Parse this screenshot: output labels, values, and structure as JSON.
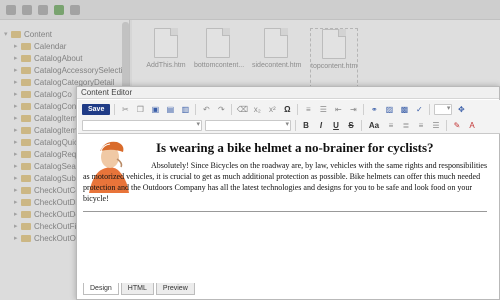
{
  "tree": {
    "root": "Content",
    "items": [
      "Calendar",
      "CatalogAbout",
      "CatalogAccessorySelection",
      "CatalogCategoryDetail",
      "CatalogCo",
      "CatalogCon",
      "CatalogItem",
      "CatalogItem",
      "CatalogQuick",
      "CatalogReque",
      "CatalogSear",
      "CatalogSubs",
      "CheckOutCo",
      "CheckOutDi",
      "CheckOutDe",
      "CheckOutFi",
      "CheckOutOr"
    ]
  },
  "files": [
    {
      "name": "AddThis.htm"
    },
    {
      "name": "bottomcontent..."
    },
    {
      "name": "sidecontent.htm"
    },
    {
      "name": "topcontent.htm"
    }
  ],
  "dialog": {
    "title": "Content Editor",
    "save_label": "Save"
  },
  "content": {
    "heading": "Is wearing a bike helmet a no-brainer for cyclists?",
    "paragraph": "Absolutely! Since Bicycles on the roadway are, by law, vehicles with the same rights and responsibilities as motorized vehicles, it is crucial to get as much additional protection as possible. Bike helmets can offer this much needed protection and the Outdoors Company has all the latest technologies and designs for you to be safe and look food on your bicycle!"
  },
  "tabs": [
    "Design",
    "HTML",
    "Preview"
  ],
  "colors": {
    "save_button": "#1f3b86",
    "folder": "#d9b96a"
  },
  "icons": {
    "toolbar_row1": [
      "cut-icon",
      "copy-icon",
      "paste-icon",
      "paste-text-icon",
      "paste-word-icon",
      "undo-icon",
      "redo-icon",
      "format-stripper-icon",
      "subscript-icon",
      "superscript-icon",
      "symbol-icon",
      "numbered-list-icon",
      "bullet-list-icon",
      "outdent-icon",
      "indent-icon",
      "link-icon",
      "image-icon",
      "media-icon",
      "spellcheck-icon",
      "table-icon",
      "module-icon"
    ],
    "toolbar_row2": [
      "bold-icon",
      "italic-icon",
      "underline-icon",
      "strikethrough-icon",
      "font-size-icon",
      "align-left-icon",
      "align-center-icon",
      "align-right-icon",
      "justify-icon",
      "highlight-color-icon",
      "font-color-icon"
    ]
  }
}
